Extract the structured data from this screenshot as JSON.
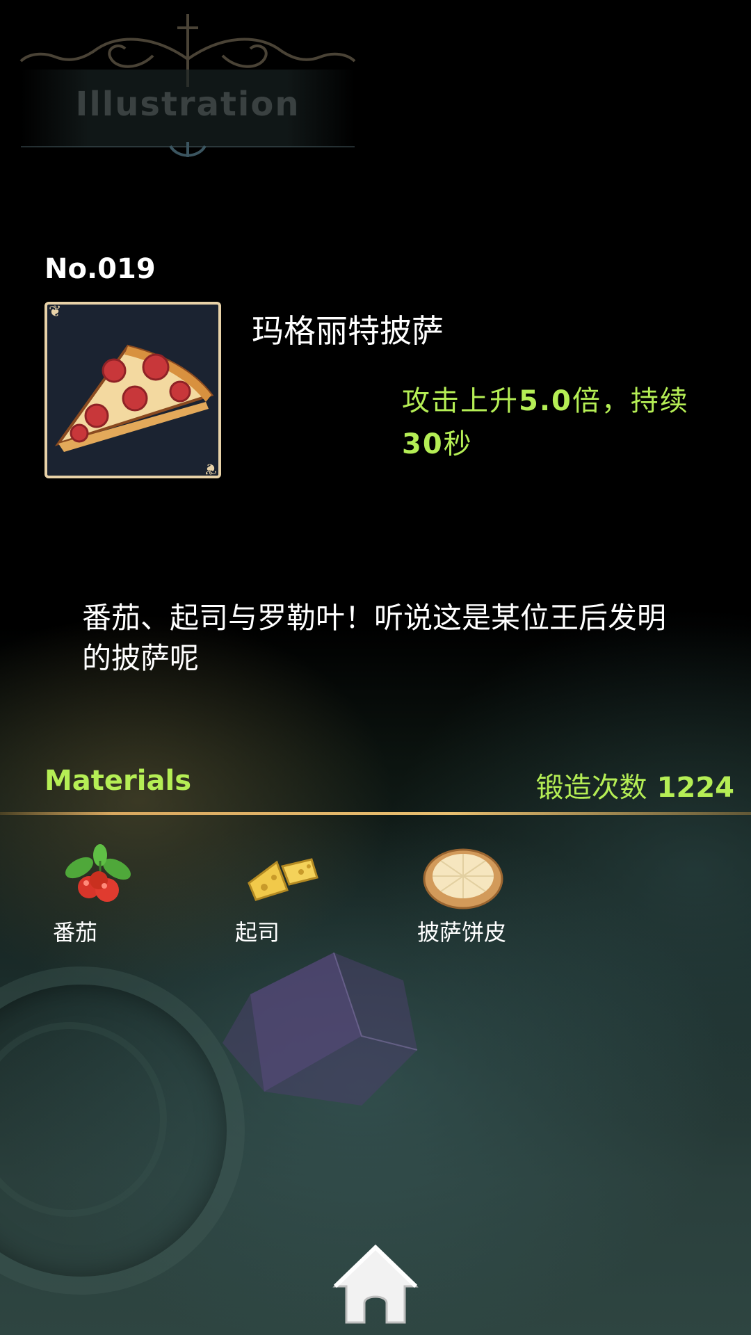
{
  "header": {
    "title": "Illustration"
  },
  "item": {
    "number": "No.019",
    "name": "玛格丽特披萨",
    "effect": {
      "prefix": "攻击上升",
      "multiplier": "5.0",
      "middle": "倍，持续",
      "duration": "30",
      "suffix": "秒"
    },
    "image": "pizza-slice-icon",
    "description": "番茄、起司与罗勒叶！听说这是某位王后发明的披萨呢"
  },
  "materials": {
    "label": "Materials",
    "forge_label": "锻造次数",
    "forge_count": "1224",
    "items": [
      {
        "name": "番茄",
        "icon": "tomato-icon"
      },
      {
        "name": "起司",
        "icon": "cheese-icon"
      },
      {
        "name": "披萨饼皮",
        "icon": "pizza-crust-icon"
      }
    ]
  },
  "nav": {
    "home_icon": "home-icon"
  },
  "colors": {
    "accent": "#b5ee55",
    "frame": "#e8d2a8",
    "background": "#000000"
  }
}
